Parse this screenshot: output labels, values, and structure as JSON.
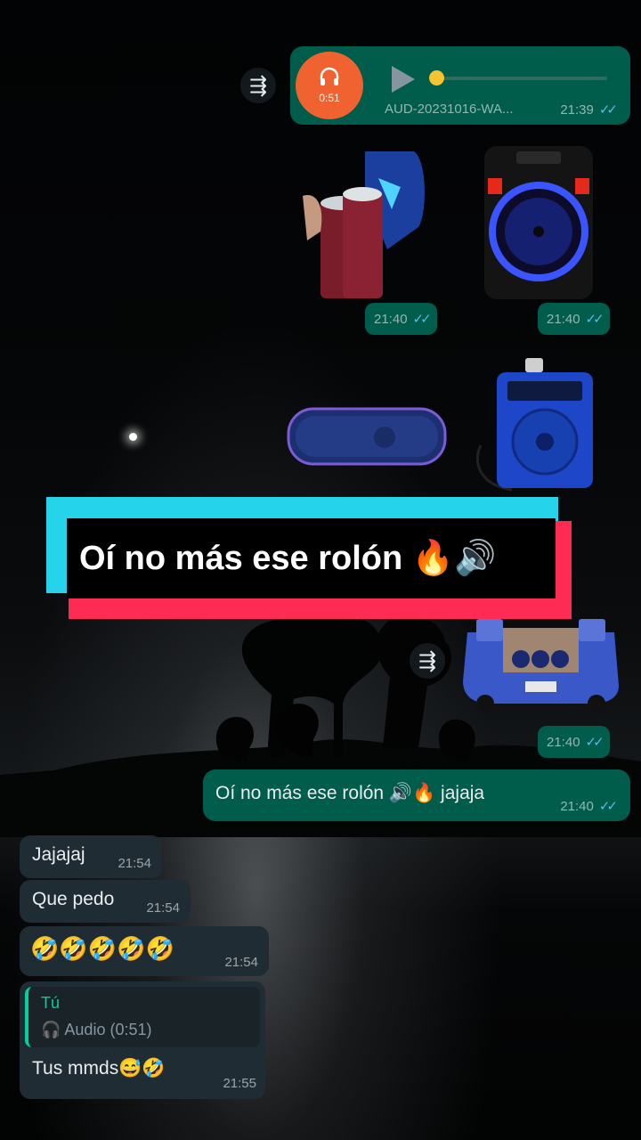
{
  "audio_message": {
    "duration": "0:51",
    "file_name": "AUD-20231016-WA...",
    "time": "21:39"
  },
  "stickers": [
    {
      "time": "21:40"
    },
    {
      "time": "21:40"
    },
    {
      "time": "21:40"
    }
  ],
  "caption_overlay": "Oí no más ese rolón 🔥🔊",
  "outgoing_text": {
    "text": "Oí no más ese rolón 🔊🔥 jajaja",
    "time": "21:40"
  },
  "incoming": [
    {
      "text": "Jajajaj",
      "time": "21:54"
    },
    {
      "text": "Que pedo",
      "time": "21:54"
    },
    {
      "text": "🤣🤣🤣🤣🤣",
      "time": "21:54"
    }
  ],
  "reply_message": {
    "quoted_name": "Tú",
    "quoted_text": "🎧 Audio (0:51)",
    "text": "Tus mmds😅🤣",
    "time": "21:55"
  },
  "colors": {
    "outgoing": "#005c4b",
    "incoming": "#202c33",
    "ticks": "#53bdeb",
    "avatar": "#f0622f"
  },
  "icons": [
    "forward-icon",
    "headphones-icon",
    "play-icon",
    "double-check-icon"
  ]
}
